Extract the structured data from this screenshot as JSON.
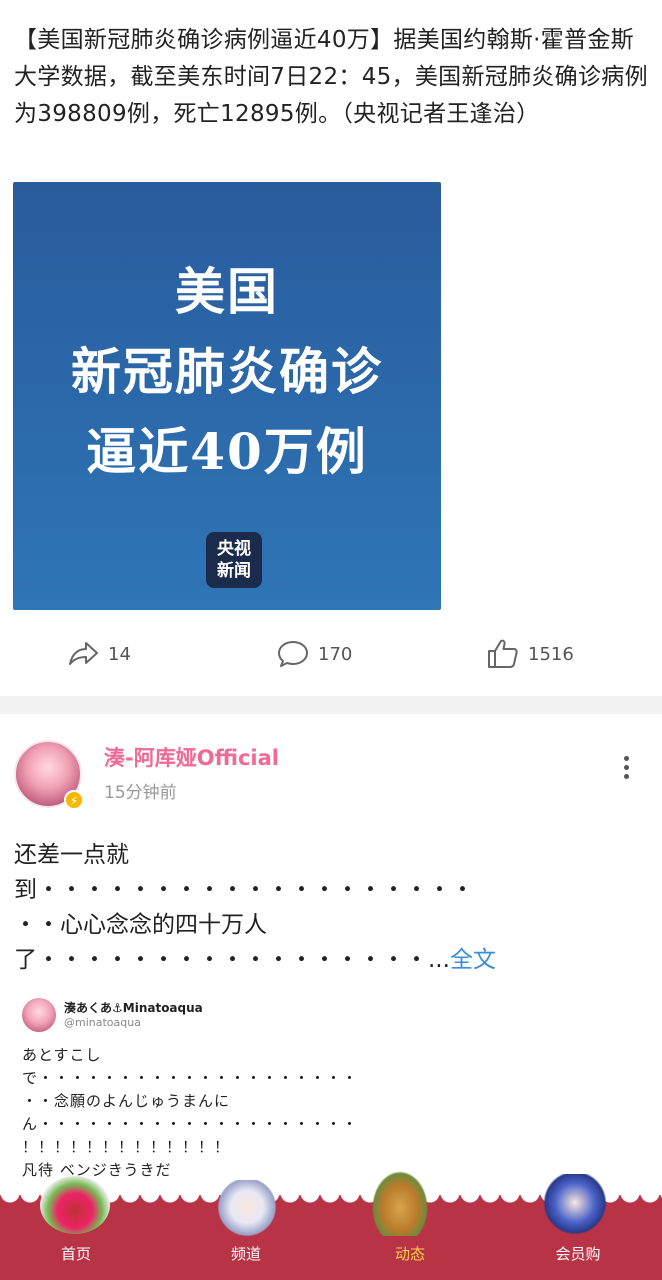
{
  "post1": {
    "text": "【美国新冠肺炎确诊病例逼近40万】据美国约翰斯·霍普金斯大学数据，截至美东时间7日22：45，美国新冠肺炎确诊病例为398809例，死亡12895例。（央视记者王逢治）",
    "card": {
      "headline_line1": "美国",
      "headline_line2": "新冠肺炎确诊",
      "headline_line3": "逼近40万例",
      "logo_line1": "央视",
      "logo_line2": "新闻"
    },
    "actions": {
      "share_count": "14",
      "comment_count": "170",
      "like_count": "1516"
    }
  },
  "post2": {
    "user_name": "湊-阿库娅Official",
    "time": "15分钟前",
    "text_line1": "还差一点就",
    "text_line2": "到・・・・・・・・・・・・・・・・・・・",
    "text_line3": "・・心心念念的四十万人",
    "text_line4": "了・・・・・・・・・・・・・・・・・...",
    "full_link": "全文",
    "quote": {
      "name": "湊あくあ⚓Minatoaqua",
      "handle": "@minatoaqua",
      "line1": "あとすこし",
      "line2": "で・・・・・・・・・・・・・・・・・・・・",
      "line3": "・・念願のよんじゅうまんに",
      "line4": "ん・・・・・・・・・・・・・・・・・・・・",
      "line5": "！！！！！！！！！！！！！",
      "line6": "凡待 ベンジきうきだ"
    }
  },
  "tabbar": {
    "tabs": [
      {
        "label": "首页"
      },
      {
        "label": "频道"
      },
      {
        "label": "动态"
      },
      {
        "label": "会员购"
      }
    ],
    "active_color": "#ffd24a",
    "bar_color": "#b93346"
  }
}
